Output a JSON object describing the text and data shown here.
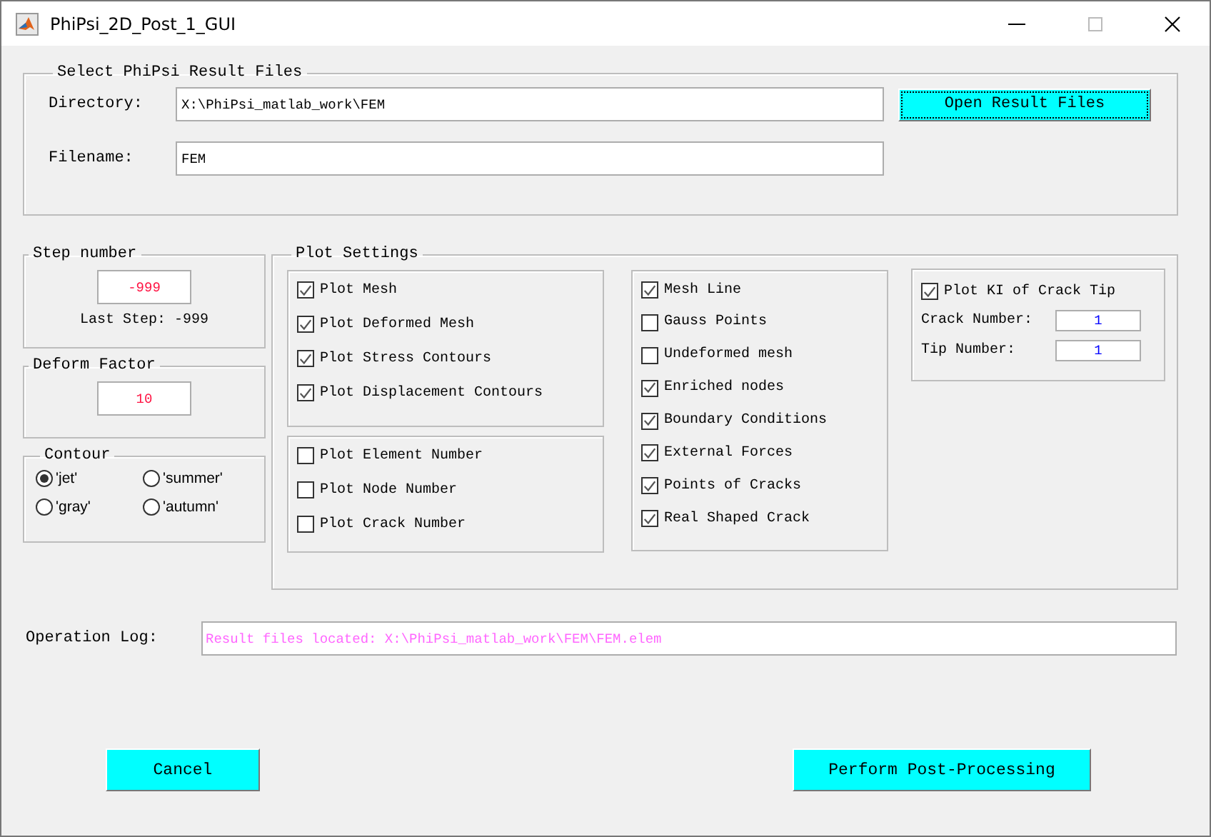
{
  "window": {
    "title": "PhiPsi_2D_Post_1_GUI"
  },
  "file_section": {
    "title": "Select PhiPsi Result Files",
    "directory_label": "Directory:",
    "directory_value": "X:\\PhiPsi_matlab_work\\FEM",
    "filename_label": "Filename:",
    "filename_value": "FEM",
    "open_button": "Open Result Files"
  },
  "step_number": {
    "title": "Step number",
    "value": "-999",
    "last_step": "Last Step: -999"
  },
  "deform_factor": {
    "title": "Deform Factor",
    "value": "10"
  },
  "contour": {
    "title": "Contour",
    "options": [
      {
        "label": "'jet'",
        "selected": true
      },
      {
        "label": "'summer'",
        "selected": false
      },
      {
        "label": "'gray'",
        "selected": false
      },
      {
        "label": "'autumn'",
        "selected": false
      }
    ]
  },
  "plot_settings": {
    "title": "Plot Settings",
    "groups": [
      {
        "items": [
          {
            "label": "Plot Mesh",
            "checked": true
          },
          {
            "label": "Plot Deformed Mesh",
            "checked": true
          },
          {
            "label": "Plot Stress Contours",
            "checked": true
          },
          {
            "label": "Plot Displacement Contours",
            "checked": true
          }
        ]
      },
      {
        "items": [
          {
            "label": "Plot Element Number",
            "checked": false
          },
          {
            "label": "Plot Node Number",
            "checked": false
          },
          {
            "label": "Plot Crack Number",
            "checked": false
          }
        ]
      },
      {
        "items": [
          {
            "label": "Mesh Line",
            "checked": true
          },
          {
            "label": "Gauss Points",
            "checked": false
          },
          {
            "label": "Undeformed mesh",
            "checked": false
          },
          {
            "label": "Enriched nodes",
            "checked": true
          },
          {
            "label": "Boundary Conditions",
            "checked": true
          },
          {
            "label": "External Forces",
            "checked": true
          },
          {
            "label": "Points of Cracks",
            "checked": true
          },
          {
            "label": "Real Shaped Crack",
            "checked": true
          }
        ]
      }
    ],
    "ki": {
      "label": "Plot KI of Crack Tip",
      "checked": true,
      "fields": [
        {
          "label": "Crack Number:",
          "value": "1"
        },
        {
          "label": "Tip Number:",
          "value": "1"
        }
      ]
    }
  },
  "operation_log": {
    "label": "Operation Log:",
    "value": "Result files located: X:\\PhiPsi_matlab_work\\FEM\\FEM.elem"
  },
  "buttons": [
    {
      "kind": "cancel",
      "label": "Cancel"
    },
    {
      "kind": "perform",
      "label": "Perform Post-Processing"
    }
  ]
}
